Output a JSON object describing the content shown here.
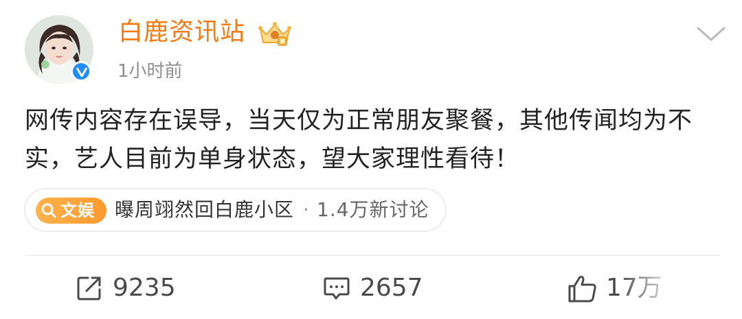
{
  "post": {
    "username": "白鹿资讯站",
    "timestamp": "1小时前",
    "content": "网传内容存在误导，当天仅为正常朋友聚餐，其他传闻均为不实，艺人目前为单身状态，望大家理性看待！",
    "topic": {
      "badge": "文娱",
      "badge_icon": "search-icon",
      "title": "曝周翊然回白鹿小区",
      "separator": "·",
      "discussion": "1.4万新讨论"
    },
    "actions": {
      "repost_count": "9235",
      "comment_count": "2657",
      "like_count": "17万"
    }
  },
  "colors": {
    "username": "#f47a12",
    "badge": "#ff9a2e",
    "verified": "#1f8cff",
    "text": "#222222",
    "muted": "#8e8e8e"
  },
  "icons": {
    "verified": "verified-badge-icon",
    "crown": "crown-badge-icon",
    "menu": "chevron-down-icon",
    "repost": "repost-icon",
    "comment": "comment-icon",
    "like": "thumbs-up-icon"
  }
}
